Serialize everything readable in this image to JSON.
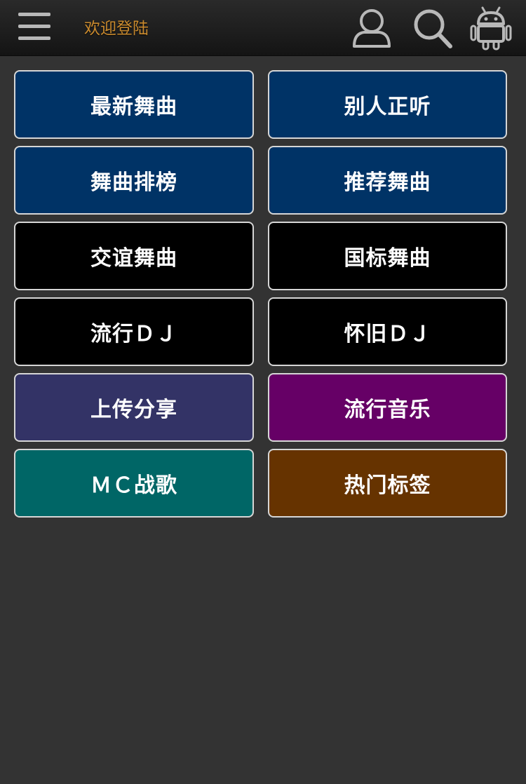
{
  "header": {
    "welcome_text": "欢迎登陆",
    "icons": [
      "menu-icon",
      "user-icon",
      "search-icon",
      "android-icon"
    ]
  },
  "colors": {
    "background": "#333333",
    "header": "#1e1e1e",
    "welcome": "#c98a2e",
    "icon": "#b8b8b8",
    "tile_border": "#d6d6d6",
    "tile_text": "#ffffff"
  },
  "tiles": [
    {
      "label": "最新舞曲",
      "color": "#003366"
    },
    {
      "label": "别人正听",
      "color": "#003366"
    },
    {
      "label": "舞曲排榜",
      "color": "#003366"
    },
    {
      "label": "推荐舞曲",
      "color": "#003366"
    },
    {
      "label": "交谊舞曲",
      "color": "#000000"
    },
    {
      "label": "国标舞曲",
      "color": "#000000"
    },
    {
      "label": "流行ＤＪ",
      "color": "#000000"
    },
    {
      "label": "怀旧ＤＪ",
      "color": "#000000"
    },
    {
      "label": "上传分享",
      "color": "#333366"
    },
    {
      "label": "流行音乐",
      "color": "#660066"
    },
    {
      "label": "ＭＣ战歌",
      "color": "#006666"
    },
    {
      "label": "热门标签",
      "color": "#663300"
    }
  ]
}
